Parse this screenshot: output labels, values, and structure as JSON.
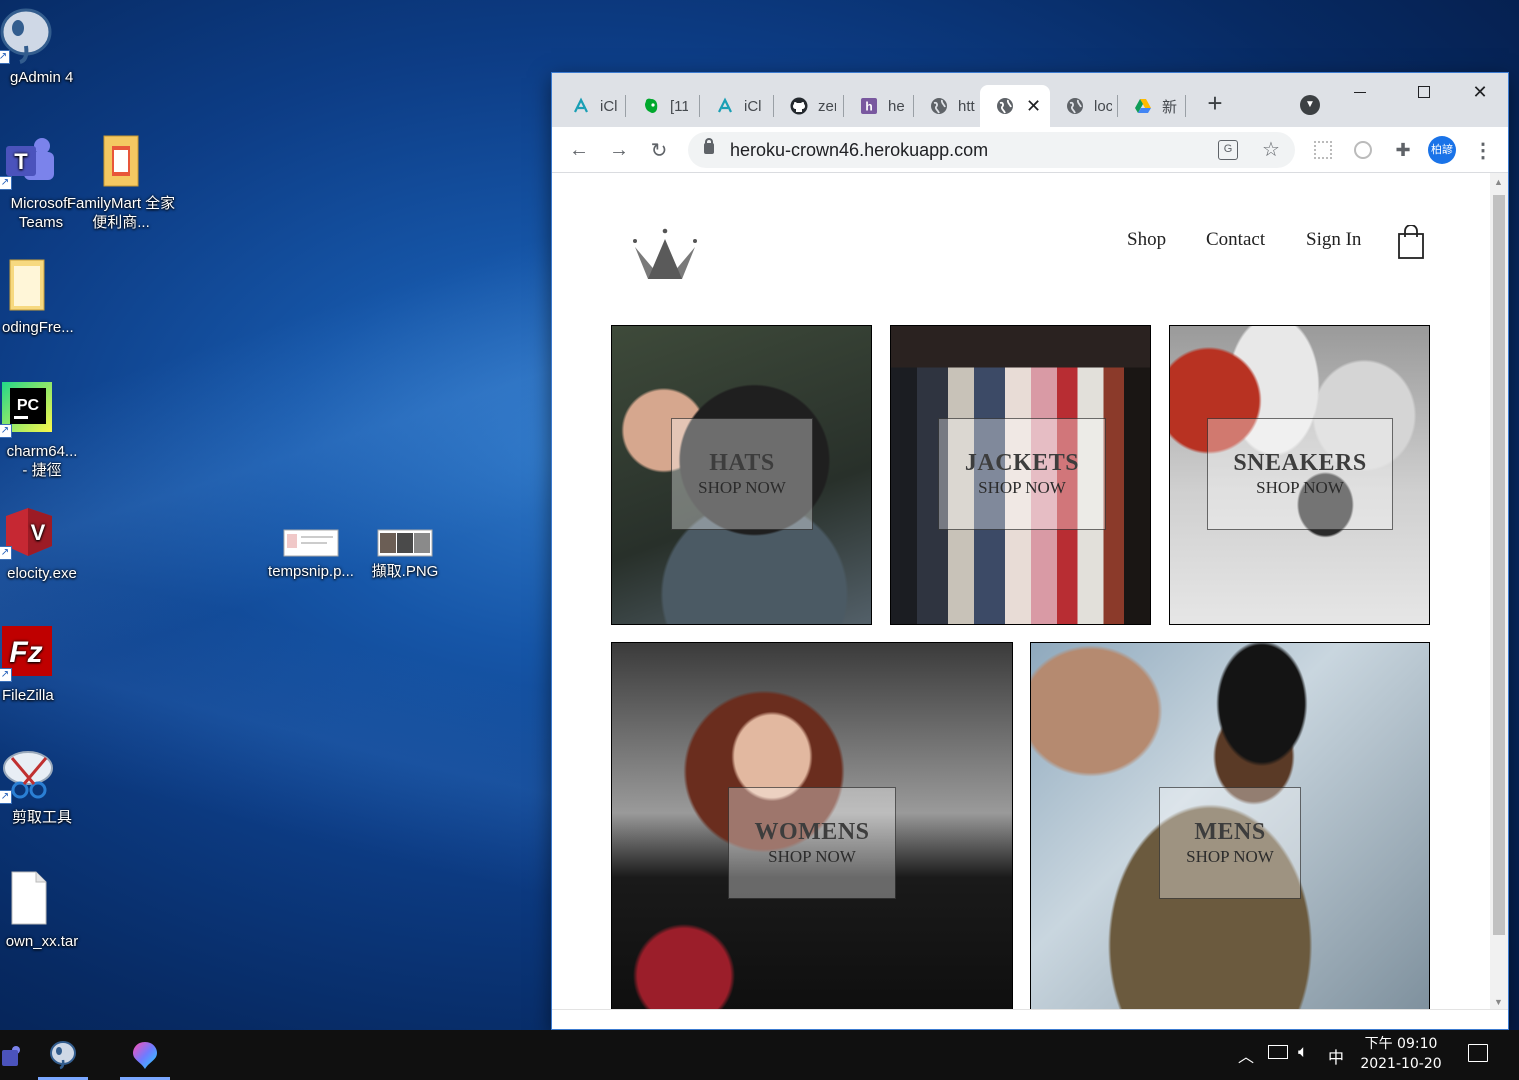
{
  "desktop": {
    "icons": [
      {
        "label": "gAdmin 4"
      },
      {
        "label": "Microsoft Teams"
      },
      {
        "label": "FamilyMart 全家便利商..."
      },
      {
        "label": "odingFre..."
      },
      {
        "label": "charm64... - 捷徑"
      },
      {
        "label": "elocity.exe"
      },
      {
        "label": "tempsnip.p..."
      },
      {
        "label": "擷取.PNG"
      },
      {
        "label": "FileZilla"
      },
      {
        "label": "剪取工具"
      },
      {
        "label": "own_xx.tar"
      }
    ]
  },
  "browser": {
    "tabs": [
      {
        "title": "iCl",
        "icon": "iclass-icon"
      },
      {
        "title": "[11",
        "icon": "evernote-icon"
      },
      {
        "title": "iCl",
        "icon": "iclass-icon"
      },
      {
        "title": "zer",
        "icon": "github-icon"
      },
      {
        "title": "he",
        "icon": "heroku-icon"
      },
      {
        "title": "htt",
        "icon": "globe-icon"
      },
      {
        "title": "",
        "icon": "globe-icon"
      },
      {
        "title": "loc",
        "icon": "globe-icon"
      },
      {
        "title": "新",
        "icon": "google-drive-icon"
      }
    ],
    "url": "heroku-crown46.herokuapp.com",
    "profile_label": "柏諺"
  },
  "site": {
    "nav": {
      "shop": "Shop",
      "contact": "Contact",
      "sign_in": "Sign In"
    },
    "categories": [
      {
        "title": "HATS",
        "cta": "SHOP NOW"
      },
      {
        "title": "JACKETS",
        "cta": "SHOP NOW"
      },
      {
        "title": "SNEAKERS",
        "cta": "SHOP NOW"
      },
      {
        "title": "WOMENS",
        "cta": "SHOP NOW"
      },
      {
        "title": "MENS",
        "cta": "SHOP NOW"
      }
    ]
  },
  "taskbar": {
    "ime": "中",
    "time": "下午 09:10",
    "date": "2021-10-20"
  }
}
